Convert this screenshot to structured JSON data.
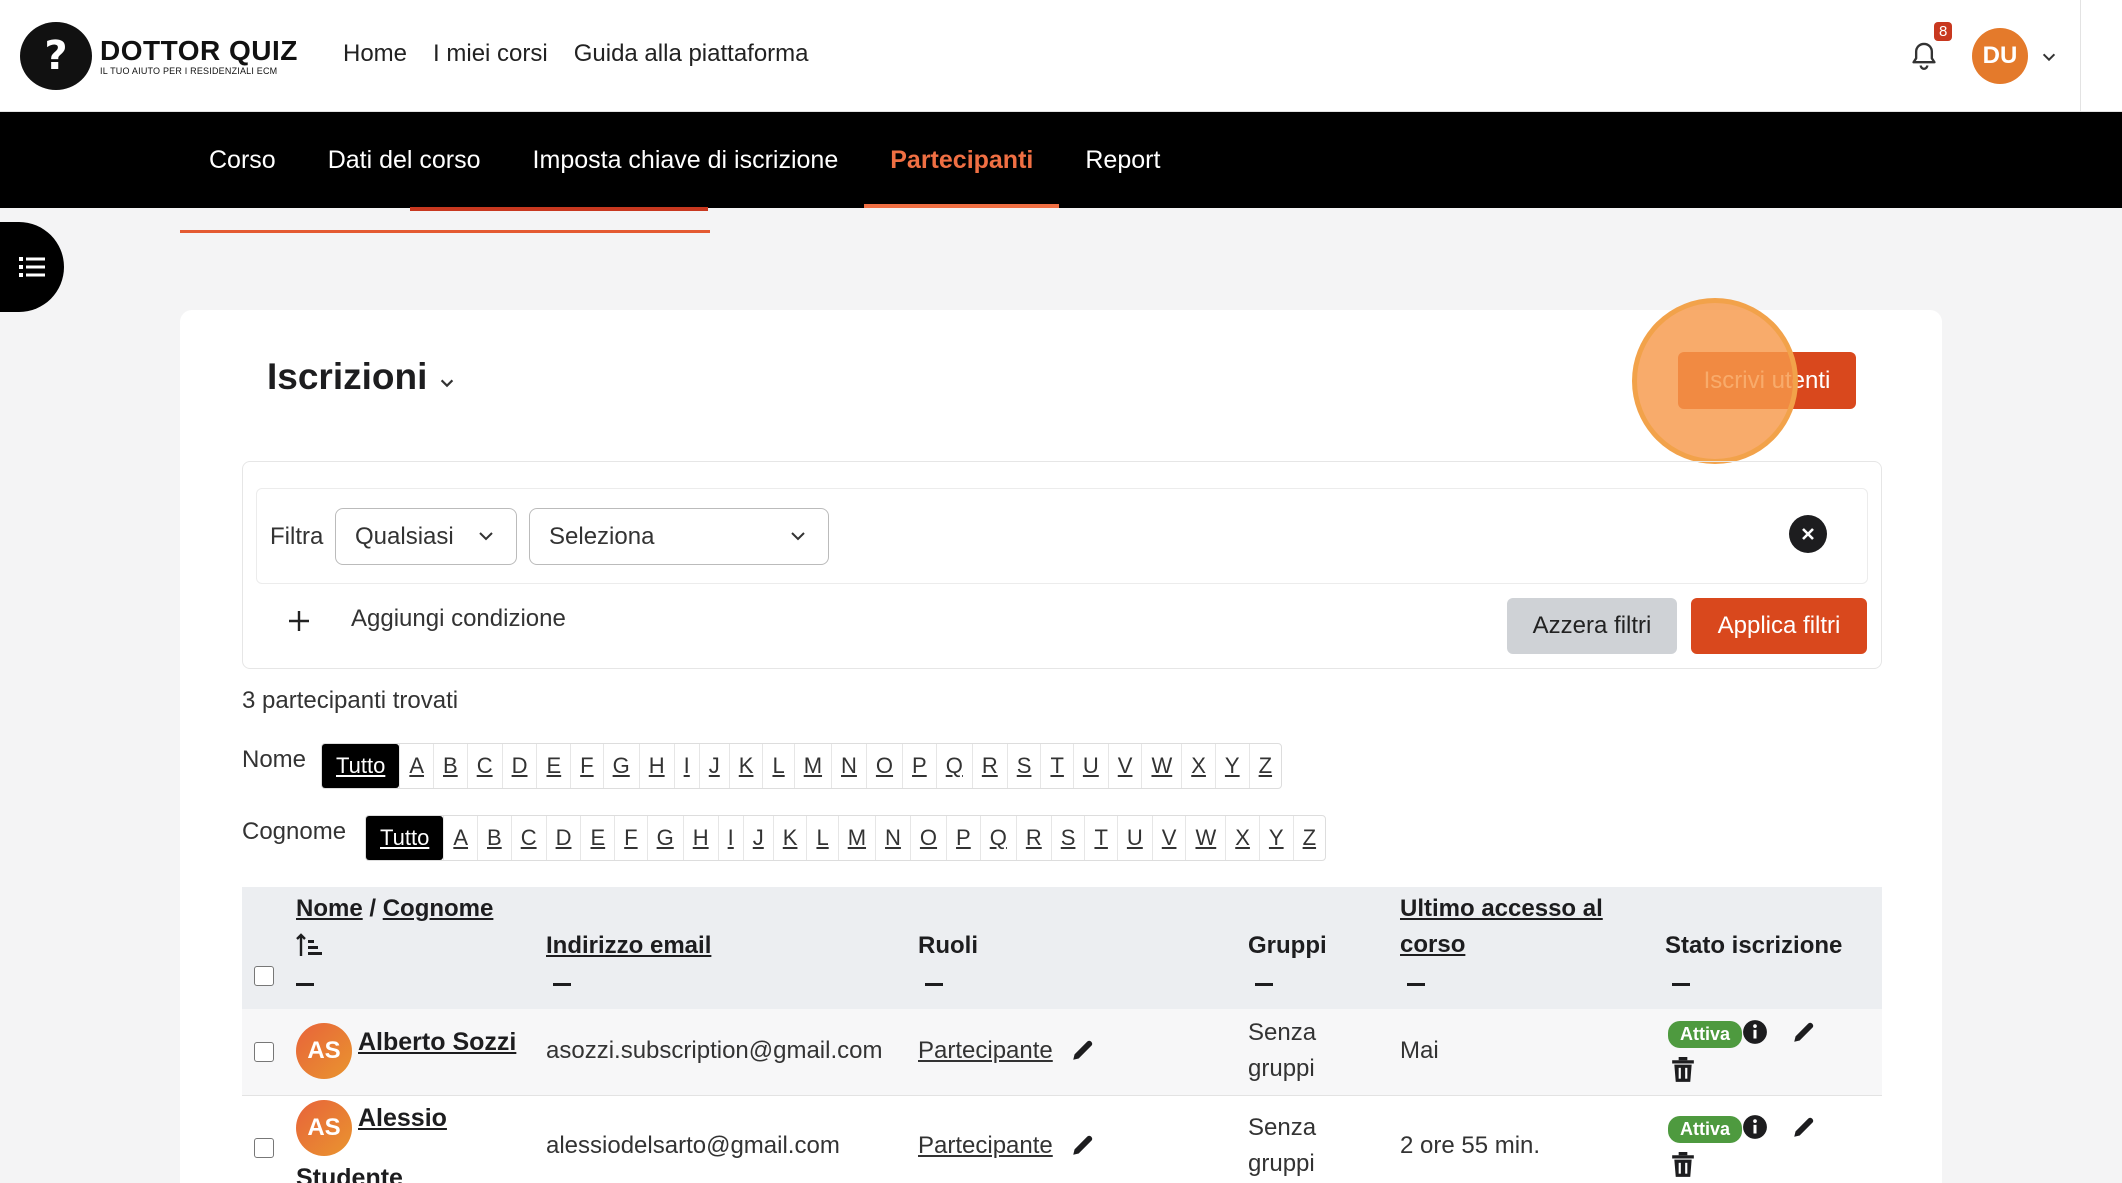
{
  "brand": {
    "logo_symbol": "?",
    "title": "DOTTOR QUIZ",
    "subtitle": "IL TUO AIUTO PER I RESIDENZIALI ECM"
  },
  "topnav": [
    "Home",
    "I miei corsi",
    "Guida alla piattaforma"
  ],
  "notifications": {
    "count": "8",
    "icon": "bell-icon"
  },
  "user": {
    "initials": "DU"
  },
  "secnav": [
    {
      "label": "Corso",
      "active": false
    },
    {
      "label": "Dati del corso",
      "active": false
    },
    {
      "label": "Imposta chiave di iscrizione",
      "active": false
    },
    {
      "label": "Partecipanti",
      "active": true
    },
    {
      "label": "Report",
      "active": false
    }
  ],
  "page": {
    "title": "Iscrizioni",
    "enrol_button": "Iscrivi utenti"
  },
  "filters": {
    "label": "Filtra",
    "match_value": "Qualsiasi",
    "type_value": "Seleziona",
    "add_condition": "Aggiungi condizione",
    "reset": "Azzera filtri",
    "apply": "Applica filtri"
  },
  "found": "3 partecipanti trovati",
  "initials": {
    "first_label": "Nome",
    "last_label": "Cognome",
    "all": "Tutto",
    "letters": [
      "A",
      "B",
      "C",
      "D",
      "E",
      "F",
      "G",
      "H",
      "I",
      "J",
      "K",
      "L",
      "M",
      "N",
      "O",
      "P",
      "Q",
      "R",
      "S",
      "T",
      "U",
      "V",
      "W",
      "X",
      "Y",
      "Z"
    ]
  },
  "table": {
    "headers": {
      "name_first": "Nome",
      "name_sep": " / ",
      "name_last": "Cognome",
      "email": "Indirizzo email",
      "roles": "Ruoli",
      "groups": "Gruppi",
      "last_access_1": "Ultimo accesso al",
      "last_access_2": "corso",
      "status": "Stato iscrizione"
    },
    "rows": [
      {
        "initials": "AS",
        "name_line1": "Alberto Sozzi",
        "name_line2": "",
        "email": "asozzi.subscription@gmail.com",
        "role": "Partecipante",
        "group_1": "Senza",
        "group_2": "gruppi",
        "last_access": "Mai",
        "status": "Attiva"
      },
      {
        "initials": "AS",
        "name_line1": "Alessio",
        "name_line2": "Studente",
        "email": "alessiodelsarto@gmail.com",
        "role": "Partecipante",
        "group_1": "Senza",
        "group_2": "gruppi",
        "last_access": "2 ore 55 min.",
        "status": "Attiva"
      }
    ]
  },
  "colors": {
    "accent": "#d9481d",
    "active_nav": "#f06f43",
    "badge_green": "#4e9a3f",
    "highlight": "#f6984b"
  }
}
